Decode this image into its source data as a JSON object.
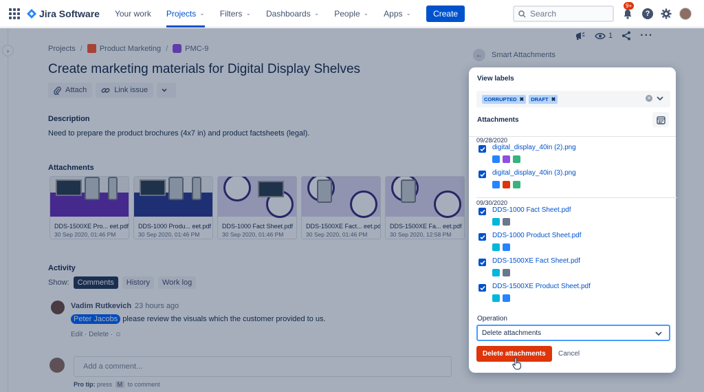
{
  "nav": {
    "logo": "Jira Software",
    "items": [
      {
        "label": "Your work",
        "chevron": false,
        "active": false
      },
      {
        "label": "Projects",
        "chevron": true,
        "active": true
      },
      {
        "label": "Filters",
        "chevron": true,
        "active": false
      },
      {
        "label": "Dashboards",
        "chevron": true,
        "active": false
      },
      {
        "label": "People",
        "chevron": true,
        "active": false
      },
      {
        "label": "Apps",
        "chevron": true,
        "active": false
      }
    ],
    "create_label": "Create",
    "search_placeholder": "Search",
    "notification_badge": "9+"
  },
  "breadcrumb": {
    "projects": "Projects",
    "project": "Product Marketing",
    "issue": "PMC-9"
  },
  "issue": {
    "title": "Create marketing materials for Digital Display Shelves",
    "attach_label": "Attach",
    "link_label": "Link issue",
    "description_heading": "Description",
    "description": "Need to prepare the product brochures (4x7 in) and product factsheets (legal).",
    "attachments_heading": "Attachments",
    "attachments": [
      {
        "name": "DDS-1500XE Pro... eet.pdf",
        "date": "30 Sep 2020, 01:46 PM",
        "style": "purple"
      },
      {
        "name": "DDS-1000 Produ... eet.pdf",
        "date": "30 Sep 2020, 01:46 PM",
        "style": "navy"
      },
      {
        "name": "DDS-1000 Fact Sheet.pdf",
        "date": "30 Sep 2020, 01:46 PM",
        "style": "lav"
      },
      {
        "name": "DDS-1500XE Fact... eet.pdf",
        "date": "30 Sep 2020, 01:46 PM",
        "style": "lav"
      },
      {
        "name": "DDS-1500XE Fa... eet.pdf",
        "date": "30 Sep 2020, 12:58 PM",
        "style": "lav"
      }
    ]
  },
  "activity": {
    "heading": "Activity",
    "show_label": "Show:",
    "filters": [
      "Comments",
      "History",
      "Work log"
    ],
    "comment": {
      "author": "Vadim Rutkevich",
      "time": "23 hours ago",
      "mention": "Peter Jacobs",
      "text": "please review the visuals which the customer provided to us.",
      "edit": "Edit",
      "delete": "Delete"
    },
    "add_comment_placeholder": "Add a comment...",
    "protip_bold": "Pro tip:",
    "protip_press": "press",
    "protip_key": "M",
    "protip_rest": "to comment"
  },
  "watchers": "1",
  "smart_attachments": {
    "header": "Smart Attachments",
    "view_labels": "View labels",
    "labels": [
      "CORRUPTED",
      "DRAFT"
    ],
    "attachments_heading": "Attachments",
    "groups": [
      {
        "date": "09/28/2020",
        "files": [
          {
            "name": "digital_display_40in (2).png",
            "colors": [
              "#2684ff",
              "#904ee2",
              "#36b37e"
            ]
          },
          {
            "name": "digital_display_40in (3).png",
            "colors": [
              "#2684ff",
              "#de350b",
              "#36b37e"
            ]
          }
        ]
      },
      {
        "date": "09/30/2020",
        "files": [
          {
            "name": "DDS-1000 Fact Sheet.pdf",
            "colors": [
              "#00b8d9",
              "#6b778c"
            ]
          },
          {
            "name": "DDS-1000 Product Sheet.pdf",
            "colors": [
              "#00b8d9",
              "#2684ff"
            ]
          },
          {
            "name": "DDS-1500XE Fact Sheet.pdf",
            "colors": [
              "#00b8d9",
              "#6b778c"
            ]
          },
          {
            "name": "DDS-1500XE Product Sheet.pdf",
            "colors": [
              "#00b8d9",
              "#2684ff"
            ]
          }
        ]
      }
    ],
    "operation_label": "Operation",
    "operation_value": "Delete attachments",
    "delete_button": "Delete attachments",
    "cancel": "Cancel"
  },
  "colors": {
    "accent": "#0052cc",
    "danger": "#de350b",
    "label_bg": "#b3d4ff"
  }
}
